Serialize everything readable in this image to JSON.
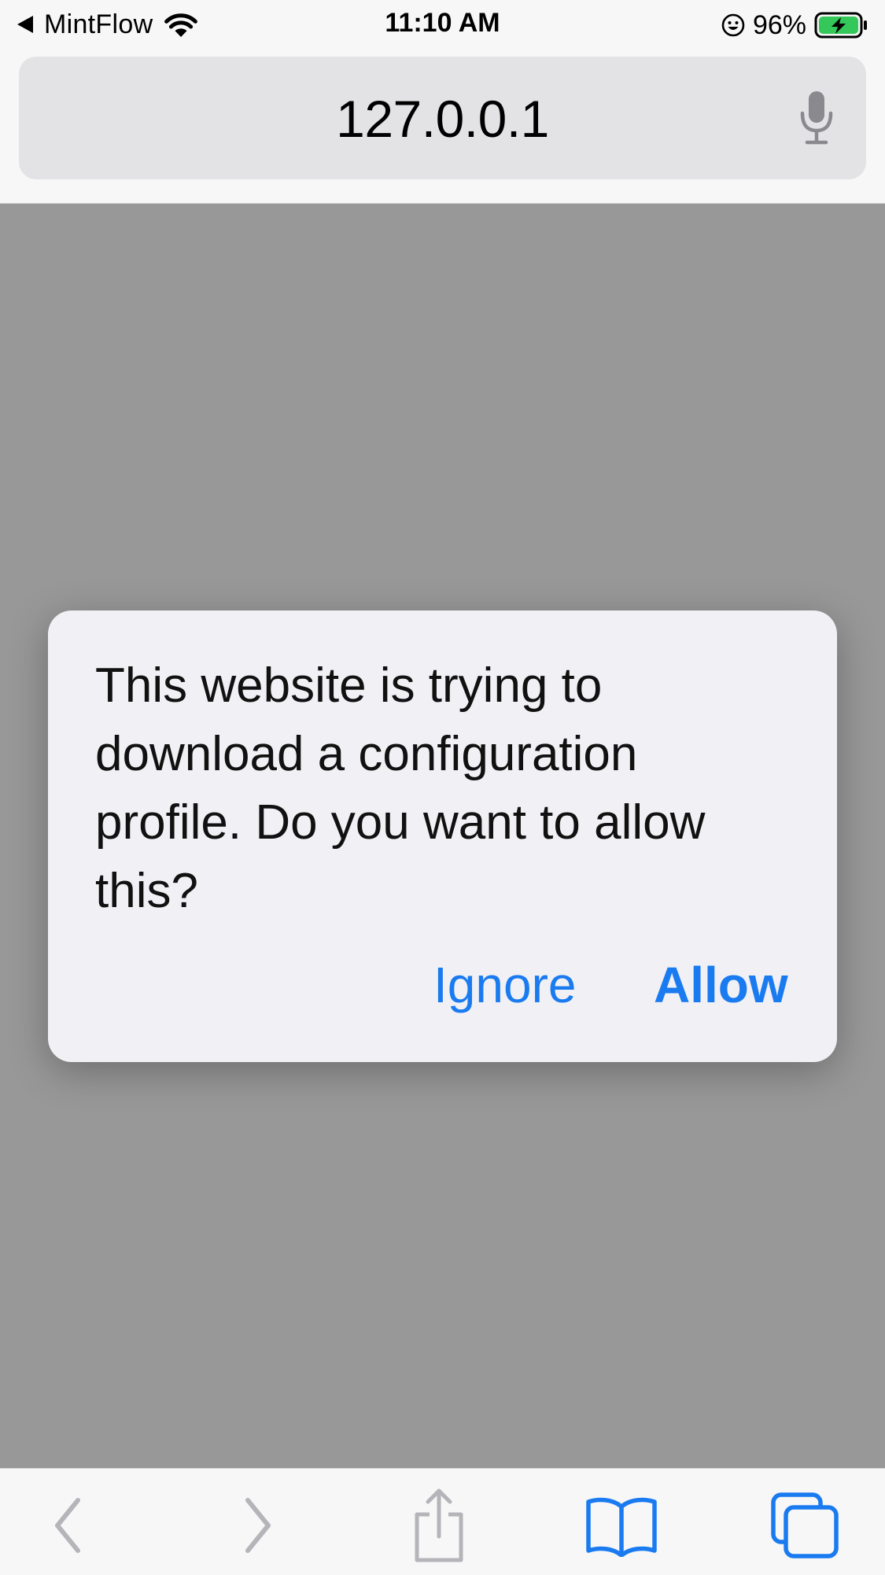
{
  "status_bar": {
    "carrier": "MintFlow",
    "time": "11:10 AM",
    "battery_percent": "96%",
    "icons": [
      "back-to-app-arrow",
      "wifi-icon",
      "face-icon",
      "battery-charging-icon"
    ]
  },
  "address_bar": {
    "url": "127.0.0.1",
    "mic_icon": "microphone-icon"
  },
  "alert": {
    "message": "This website is trying to download a configuration profile. Do you want to allow this?",
    "ignore_label": "Ignore",
    "allow_label": "Allow"
  },
  "toolbar": {
    "items": [
      "back-icon",
      "forward-icon",
      "share-icon",
      "bookmarks-icon",
      "tabs-icon"
    ]
  },
  "colors": {
    "accent": "#1a7bf0",
    "dimmed_page": "#989898",
    "alert_background": "#f1f1f5",
    "battery_fill": "#34c759"
  }
}
